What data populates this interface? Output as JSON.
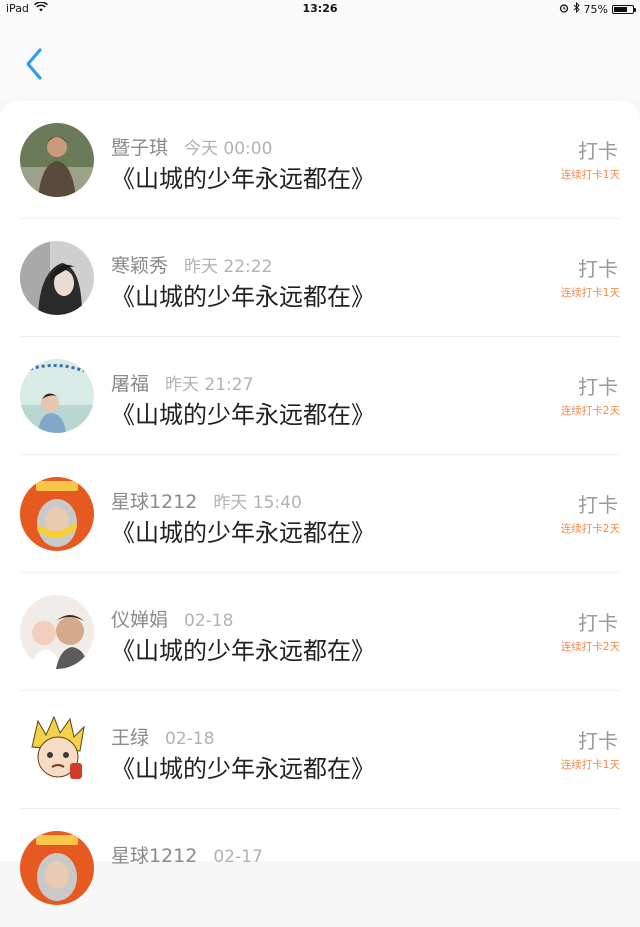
{
  "status_bar": {
    "device": "iPad",
    "time": "13:26",
    "battery": "75%",
    "battery_level": 0.75
  },
  "list": [
    {
      "name": "暨子琪",
      "time": "今天 00:00",
      "title": "《山城的少年永远都在》",
      "action": "打卡",
      "streak": "连续打卡1天"
    },
    {
      "name": "寒颖秀",
      "time": "昨天 22:22",
      "title": "《山城的少年永远都在》",
      "action": "打卡",
      "streak": "连续打卡1天"
    },
    {
      "name": "屠福",
      "time": "昨天 21:27",
      "title": "《山城的少年永远都在》",
      "action": "打卡",
      "streak": "连续打卡2天"
    },
    {
      "name": "星球1212",
      "time": "昨天 15:40",
      "title": "《山城的少年永远都在》",
      "action": "打卡",
      "streak": "连续打卡2天"
    },
    {
      "name": "仪婵娟",
      "time": "02-18",
      "title": "《山城的少年永远都在》",
      "action": "打卡",
      "streak": "连续打卡2天"
    },
    {
      "name": "王绿",
      "time": "02-18",
      "title": "《山城的少年永远都在》",
      "action": "打卡",
      "streak": "连续打卡1天"
    },
    {
      "name": "星球1212",
      "time": "02-17",
      "title": "",
      "action": "",
      "streak": ""
    }
  ]
}
